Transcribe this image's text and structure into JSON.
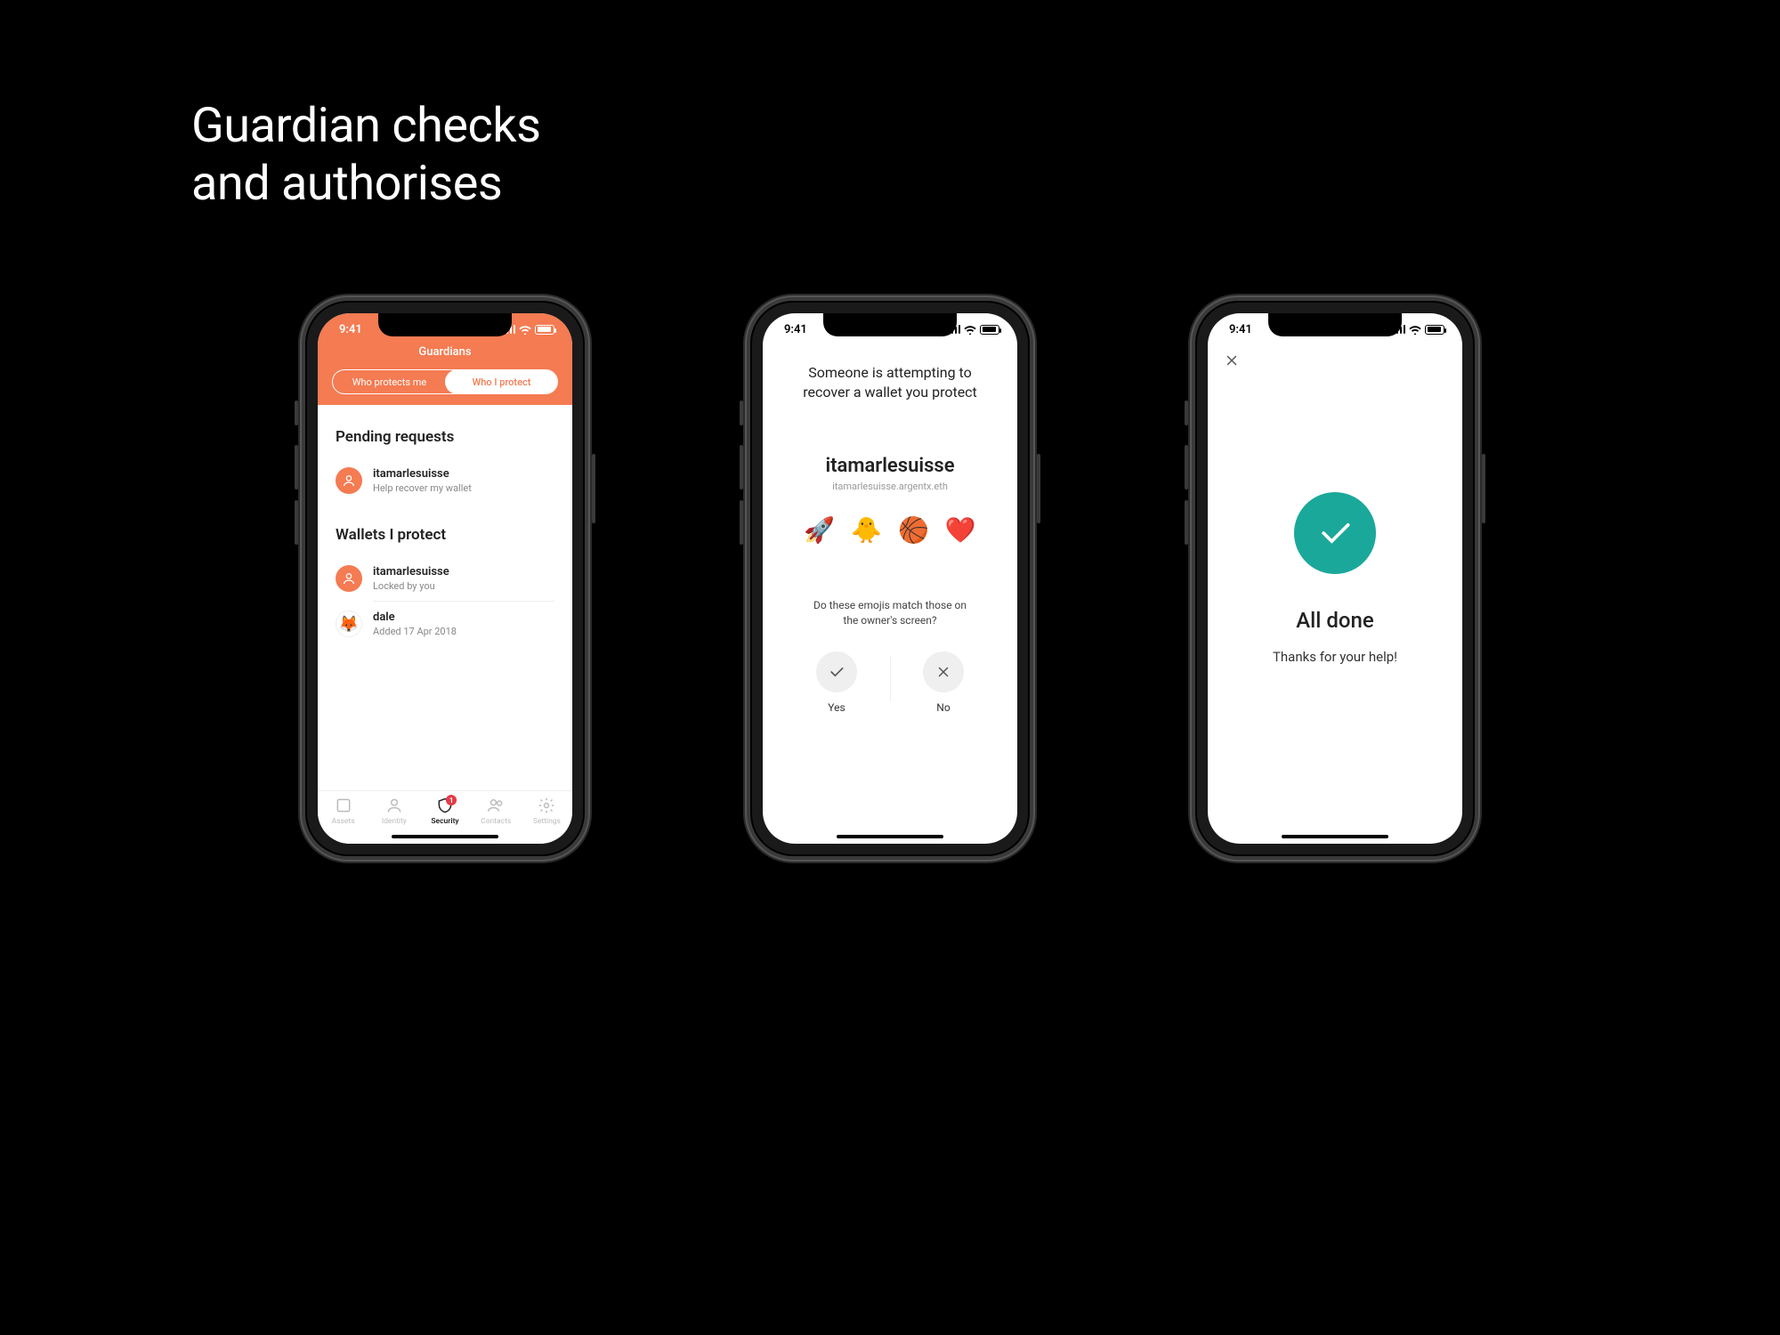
{
  "heading_line1": "Guardian checks",
  "heading_line2": "and authorises",
  "status_time": "9:41",
  "screen1": {
    "header_title": "Guardians",
    "seg_left": "Who protects me",
    "seg_right": "Who I protect",
    "pending_heading": "Pending requests",
    "pending": {
      "name": "itamarlesuisse",
      "sub": "Help recover my wallet"
    },
    "wallets_heading": "Wallets I protect",
    "wallets": [
      {
        "name": "itamarlesuisse",
        "sub": "Locked by you"
      },
      {
        "name": "dale",
        "sub": "Added 17 Apr 2018"
      }
    ],
    "tabs": {
      "assets": "Assets",
      "identity": "Identity",
      "security": "Security",
      "contacts": "Contacts",
      "settings": "Settings",
      "badge": "1"
    }
  },
  "screen2": {
    "message": "Someone is attempting to recover a wallet you protect",
    "wallet_name": "itamarlesuisse",
    "wallet_sub": "itamarlesuisse.argentx.eth",
    "emojis": [
      "🚀",
      "🐥",
      "🏀",
      "❤️"
    ],
    "question": "Do these emojis match those on the owner's screen?",
    "yes": "Yes",
    "no": "No"
  },
  "screen3": {
    "title": "All done",
    "sub": "Thanks for your help!"
  },
  "colors": {
    "accent": "#f47b52",
    "success": "#1aa89a",
    "badge": "#e63946"
  }
}
